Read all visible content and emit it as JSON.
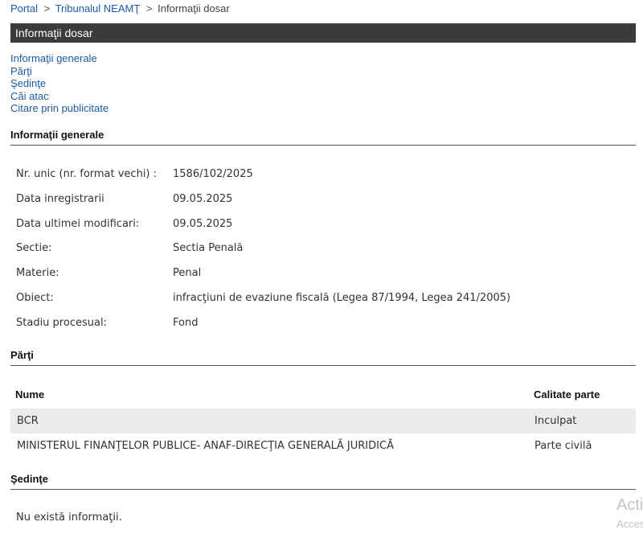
{
  "breadcrumb": {
    "items": [
      "Portal",
      "Tribunalul NEAMŢ",
      "Informaţii dosar"
    ],
    "separator": ">"
  },
  "title": "Informaţii dosar",
  "nav": [
    "Informaţii generale",
    "Părţi",
    "Şedinţe",
    "Căi atac",
    "Citare prin publicitate"
  ],
  "general": {
    "heading": "Informaţii generale",
    "rows": [
      {
        "label": "Nr. unic (nr. format vechi) :",
        "value": "1586/102/2025"
      },
      {
        "label": "Data inregistrarii",
        "value": "09.05.2025"
      },
      {
        "label": "Data ultimei modificari:",
        "value": "09.05.2025"
      },
      {
        "label": "Sectie:",
        "value": "Sectia Penală"
      },
      {
        "label": "Materie:",
        "value": "Penal"
      },
      {
        "label": "Obiect:",
        "value": "infracţiuni de evaziune fiscală (Legea 87/1994, Legea 241/2005)"
      },
      {
        "label": "Stadiu procesual:",
        "value": "Fond"
      }
    ]
  },
  "parti": {
    "heading": "Părţi",
    "columns": [
      "Nume",
      "Calitate parte"
    ],
    "rows": [
      {
        "nume": "BCR",
        "calitate": "Inculpat"
      },
      {
        "nume": "MINISTERUL FINANŢELOR PUBLICE- ANAF-DIRECŢIA GENERALĂ JURIDICĂ",
        "calitate": "Parte civilă"
      }
    ]
  },
  "sedinte": {
    "heading": "Şedinţe",
    "empty": "Nu există informaţii."
  },
  "watermark": {
    "line1": "Acti",
    "line2": "Acces"
  }
}
